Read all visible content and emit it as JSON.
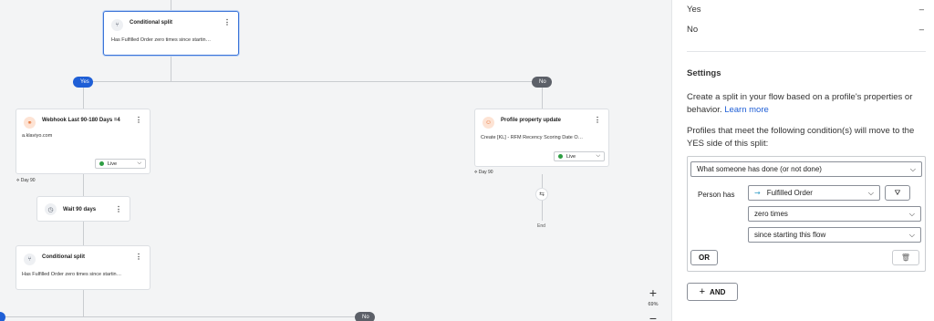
{
  "canvas": {
    "pills": {
      "yes": "Yes",
      "no": "No"
    },
    "cards": {
      "split_top": {
        "title": "Conditional split",
        "subtitle": "Has Fulfilled Order zero times since startin…"
      },
      "webhook": {
        "title": "Webhook Last 90-180 Days =4",
        "subtitle": "a.klaviyo.com",
        "status": "Live"
      },
      "profile_update": {
        "title": "Profile property update",
        "subtitle": "Create [KL] - RFM Recency Scoring Date O…",
        "status": "Live"
      },
      "wait": {
        "title": "Wait 90 days"
      },
      "split_bottom": {
        "title": "Conditional split",
        "subtitle": "Has Fulfilled Order zero times since startin…"
      }
    },
    "day_labels": {
      "left": "Day 90",
      "right": "Day 90"
    },
    "end_label": "End",
    "zoom": {
      "plus": "+",
      "level": "69%",
      "minus": "−"
    }
  },
  "panel": {
    "branches": [
      {
        "label": "Yes",
        "value": "–"
      },
      {
        "label": "No",
        "value": "–"
      }
    ],
    "settings_title": "Settings",
    "description": "Create a split in your flow based on a profile's properties or behavior.",
    "learn_more": "Learn more",
    "condition_intro": "Profiles that meet the following condition(s) will move to the YES side of this split:",
    "condition_type": "What someone has done (or not done)",
    "person_has_label": "Person has",
    "metric": "Fulfilled Order",
    "frequency": "zero times",
    "timeframe": "since starting this flow",
    "or_label": "OR",
    "and_label": "AND",
    "and_plus": "+"
  }
}
